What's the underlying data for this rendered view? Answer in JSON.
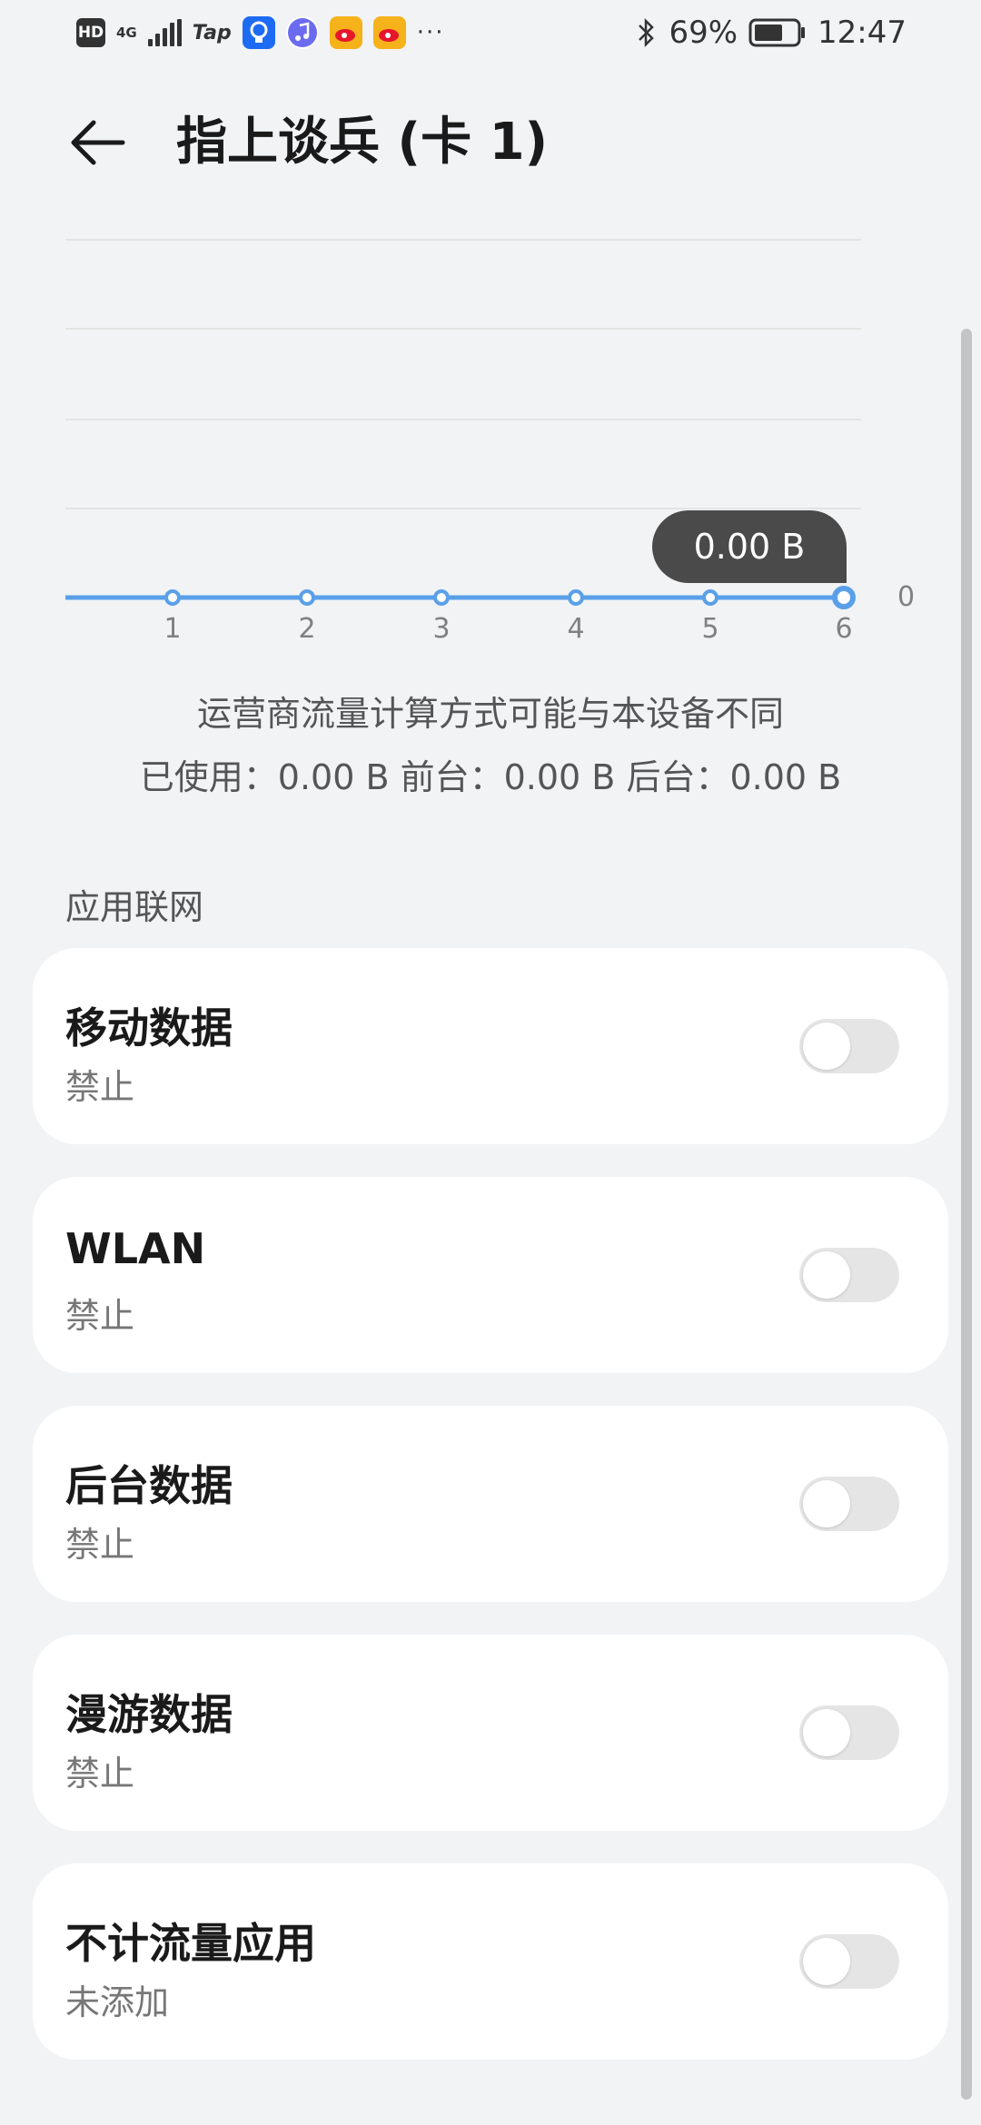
{
  "status_bar": {
    "hd": "HD",
    "network": "4G",
    "tap": "Tap",
    "more": "···",
    "battery": "69%",
    "time": "12:47"
  },
  "header": {
    "title": "指上谈兵 (卡 1)"
  },
  "chart_data": {
    "type": "line",
    "x": [
      1,
      2,
      3,
      4,
      5,
      6
    ],
    "series": [
      {
        "values": [
          0,
          0,
          0,
          0,
          0,
          0
        ]
      }
    ],
    "y_tick": "0",
    "tooltip": "0.00 B",
    "grid": true
  },
  "notes": {
    "carrier": "运营商流量计算方式可能与本设备不同",
    "usage": "已使用：0.00 B 前台：0.00 B 后台：0.00 B"
  },
  "section": {
    "title": "应用联网"
  },
  "cards": [
    {
      "title": "移动数据",
      "subtitle": "禁止",
      "enabled": false
    },
    {
      "title": "WLAN",
      "subtitle": "禁止",
      "enabled": false
    },
    {
      "title": "后台数据",
      "subtitle": "禁止",
      "enabled": false
    },
    {
      "title": "漫游数据",
      "subtitle": "禁止",
      "enabled": false
    },
    {
      "title": "不计流量应用",
      "subtitle": "未添加",
      "enabled": false
    }
  ],
  "colors": {
    "accent": "#5aa0e8",
    "background": "#f1f3f5",
    "toggle_off": "#e5e5e5"
  }
}
